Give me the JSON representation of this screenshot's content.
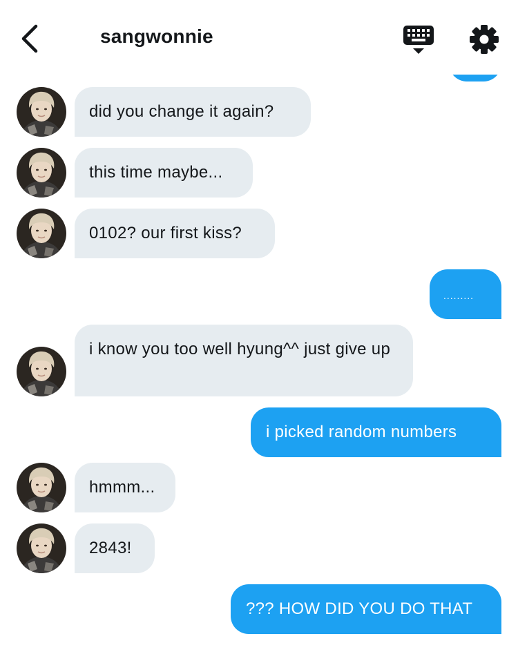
{
  "header": {
    "title": "sangwonnie"
  },
  "colors": {
    "sent_bubble": "#1da1f2",
    "received_bubble": "#e6ecf0",
    "text_dark": "#14171a"
  },
  "icons": {
    "back": "chevron-left-icon",
    "keyboard": "keyboard-icon",
    "settings": "gear-icon"
  },
  "messages": [
    {
      "direction": "received",
      "text": "did you change it again?"
    },
    {
      "direction": "received",
      "text": "this time maybe..."
    },
    {
      "direction": "received",
      "text": "0102? our first kiss?"
    },
    {
      "direction": "sent",
      "text": "........."
    },
    {
      "direction": "received",
      "text": "i know you too well hyung^^ just give up"
    },
    {
      "direction": "sent",
      "text": "i picked random numbers"
    },
    {
      "direction": "received",
      "text": "hmmm..."
    },
    {
      "direction": "received",
      "text": "2843!"
    },
    {
      "direction": "sent",
      "text": "??? HOW DID YOU DO THAT"
    }
  ]
}
